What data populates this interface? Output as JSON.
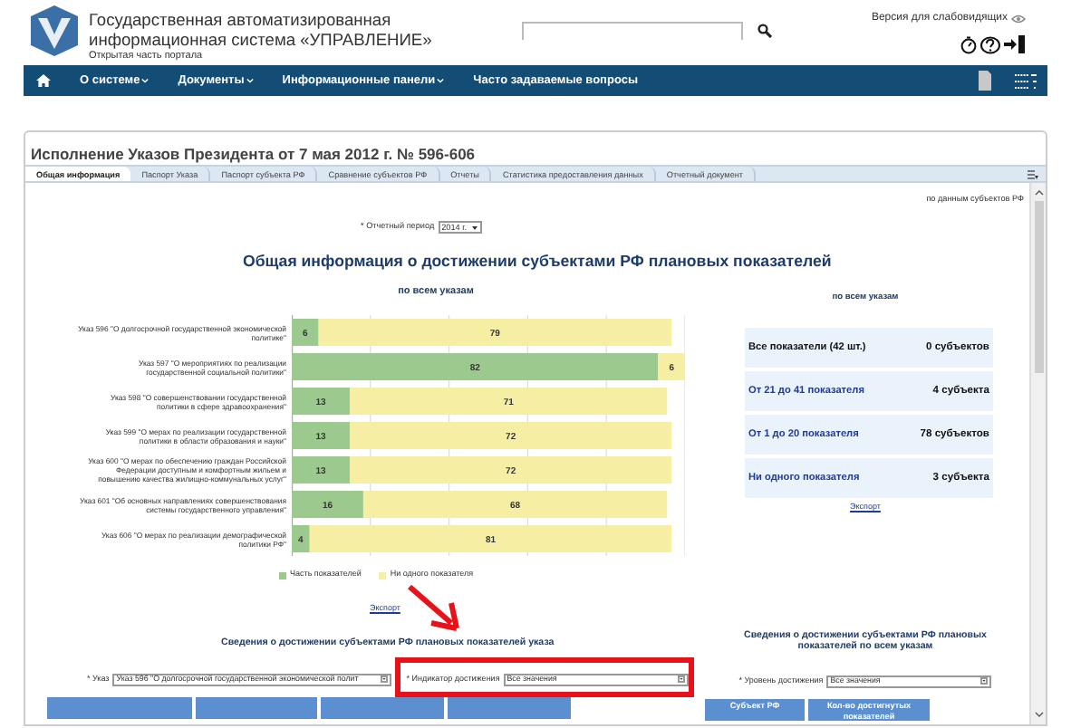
{
  "header": {
    "title_lines": [
      "Государственная автоматизированная",
      "информационная система «УПРАВЛЕНИЕ»"
    ],
    "subtitle": "Открытая часть портала",
    "accessibility_link": "Версия для слабовидящих"
  },
  "nav": {
    "items": [
      {
        "label": "О системе",
        "dropdown": true
      },
      {
        "label": "Документы",
        "dropdown": true
      },
      {
        "label": "Информационные панели",
        "dropdown": true
      },
      {
        "label": "Часто задаваемые вопросы",
        "dropdown": false
      }
    ]
  },
  "panel": {
    "title": "Исполнение Указов Президента от 7 мая 2012 г. № 596-606",
    "tabs": [
      {
        "label": "Общая информация",
        "selected": true
      },
      {
        "label": "Паспорт Указа",
        "selected": false
      },
      {
        "label": "Паспорт субъекта РФ",
        "selected": false
      },
      {
        "label": "Сравнение субъектов РФ",
        "selected": false
      },
      {
        "label": "Отчеты",
        "selected": false
      },
      {
        "label": "Статистика предоставления данных",
        "selected": false
      },
      {
        "label": "Отчетный документ",
        "selected": false
      }
    ],
    "source_note": "по данным субъектов РФ",
    "period": {
      "label": "* Отчетный период",
      "value": "2014 г."
    },
    "chart_title": "Общая информация о достижении субъектами РФ плановых показателей",
    "chart_subtitle": "по всем указам",
    "chart_data": {
      "type": "bar",
      "orientation": "horizontal",
      "stacked": true,
      "data_labels": true,
      "categories": [
        "Указ 596 \"О долгосрочной государственной экономической политике\"",
        "Указ 597 \"О мероприятиях по реализации государственной социальной политики\"",
        "Указ 598 \"О совершенствовании государственной политики в сфере здравоохранения\"",
        "Указ 599 \"О мерах по реализации государственной политики в области образования и науки\"",
        "Указ 600 \"О мерах по обеспечению граждан Российской Федерации доступным и комфортным жильем и повышению качества жилищно-коммунальных услуг\"",
        "Указ 601 \"Об основных направлениях совершенствования системы государственного управления\"",
        "Указ 606 \"О мерах по реализации демографической политики РФ\""
      ],
      "series": [
        {
          "name": "Часть показателей",
          "color": "#9cc98e",
          "values": [
            6,
            82,
            13,
            13,
            13,
            16,
            4
          ]
        },
        {
          "name": "Ни одного показателя",
          "color": "#f6efa3",
          "values": [
            79,
            6,
            71,
            72,
            72,
            68,
            81
          ]
        }
      ]
    },
    "export_link": "Экспорт",
    "summary": {
      "subtitle": "по всем указам",
      "rows": [
        {
          "kind": "total",
          "label": "Все показатели (42 шт.)",
          "value": "0 субъектов"
        },
        {
          "kind": "link",
          "label": "От 21 до 41 показателя",
          "value": "4 субъекта"
        },
        {
          "kind": "link",
          "label": "От 1 до 20 показателя",
          "value": "78 субъектов"
        },
        {
          "kind": "link",
          "label": "Ни одного показателя",
          "value": "3 субъекта"
        }
      ],
      "export_link": "Экспорт"
    },
    "decree_section": {
      "title": "Сведения о достижении субъектами РФ плановых показателей указа",
      "decree": {
        "label": "* Указ",
        "value": "Указ 596 \"О долгосрочной государственной экономической полит"
      },
      "indicator": {
        "label": "* Индикатор достижения",
        "value": "Все значения"
      }
    },
    "all_section": {
      "title": "Сведения о достижении субъектами РФ плановых показателей по всем указам",
      "level": {
        "label": "* Уровень достижения",
        "value": "Все значения"
      },
      "columns": [
        "Субъект РФ",
        "Кол-во достигнутых показателей"
      ]
    }
  }
}
